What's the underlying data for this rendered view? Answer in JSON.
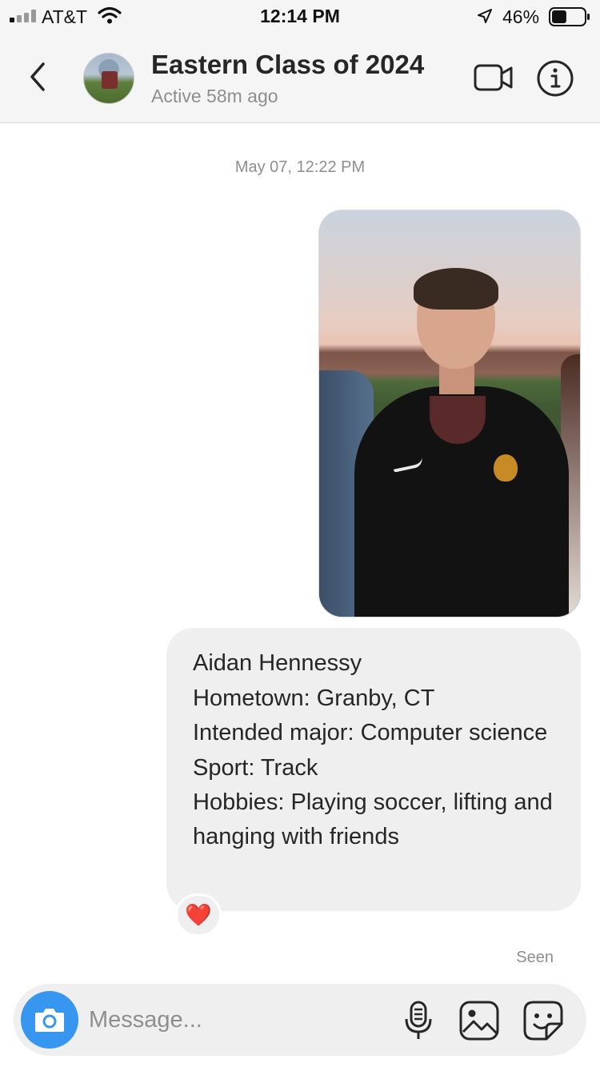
{
  "status_bar": {
    "carrier": "AT&T",
    "time": "12:14 PM",
    "battery_percent": "46%",
    "battery_level": 0.46,
    "icons": [
      "signal-icon",
      "wifi-icon",
      "location-arrow-icon",
      "battery-icon"
    ]
  },
  "header": {
    "title": "Eastern Class of 2024",
    "subtitle": "Active 58m ago",
    "icons": [
      "back-chevron-icon",
      "video-call-icon",
      "info-icon"
    ]
  },
  "thread": {
    "timestamp": "May 07, 12:22 PM",
    "message_lines": [
      "Aidan Hennessy",
      "Hometown: Granby, CT",
      "Intended major: Computer science",
      "Sport: Track",
      "Hobbies: Playing soccer, lifting and hanging with friends"
    ],
    "reaction": "❤️",
    "seen_label": "Seen"
  },
  "composer": {
    "placeholder": "Message...",
    "icons": [
      "camera-icon",
      "microphone-icon",
      "gallery-icon",
      "sticker-icon"
    ]
  },
  "colors": {
    "accent": "#3797f0",
    "bubble": "#efefef",
    "muted_text": "#8e8e8e"
  }
}
